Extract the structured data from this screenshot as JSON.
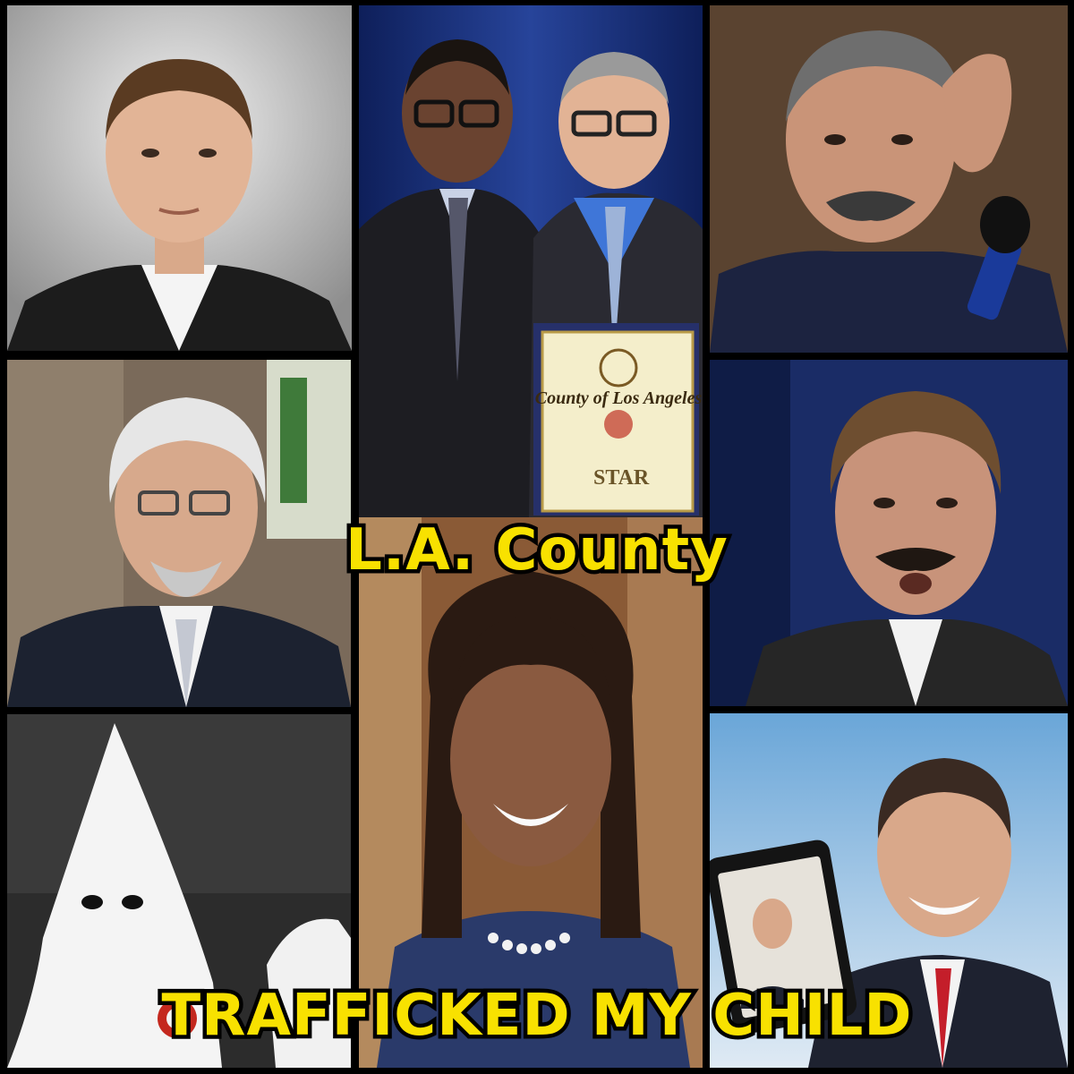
{
  "caption": {
    "top": "L.A. County",
    "bottom": "TRAFFICKED MY CHILD"
  },
  "certificate": {
    "heading": "County of Los Angeles",
    "subheading": "STAR"
  },
  "colors": {
    "caption_fill": "#f8e100",
    "caption_outline": "#000000",
    "background": "#000000"
  }
}
